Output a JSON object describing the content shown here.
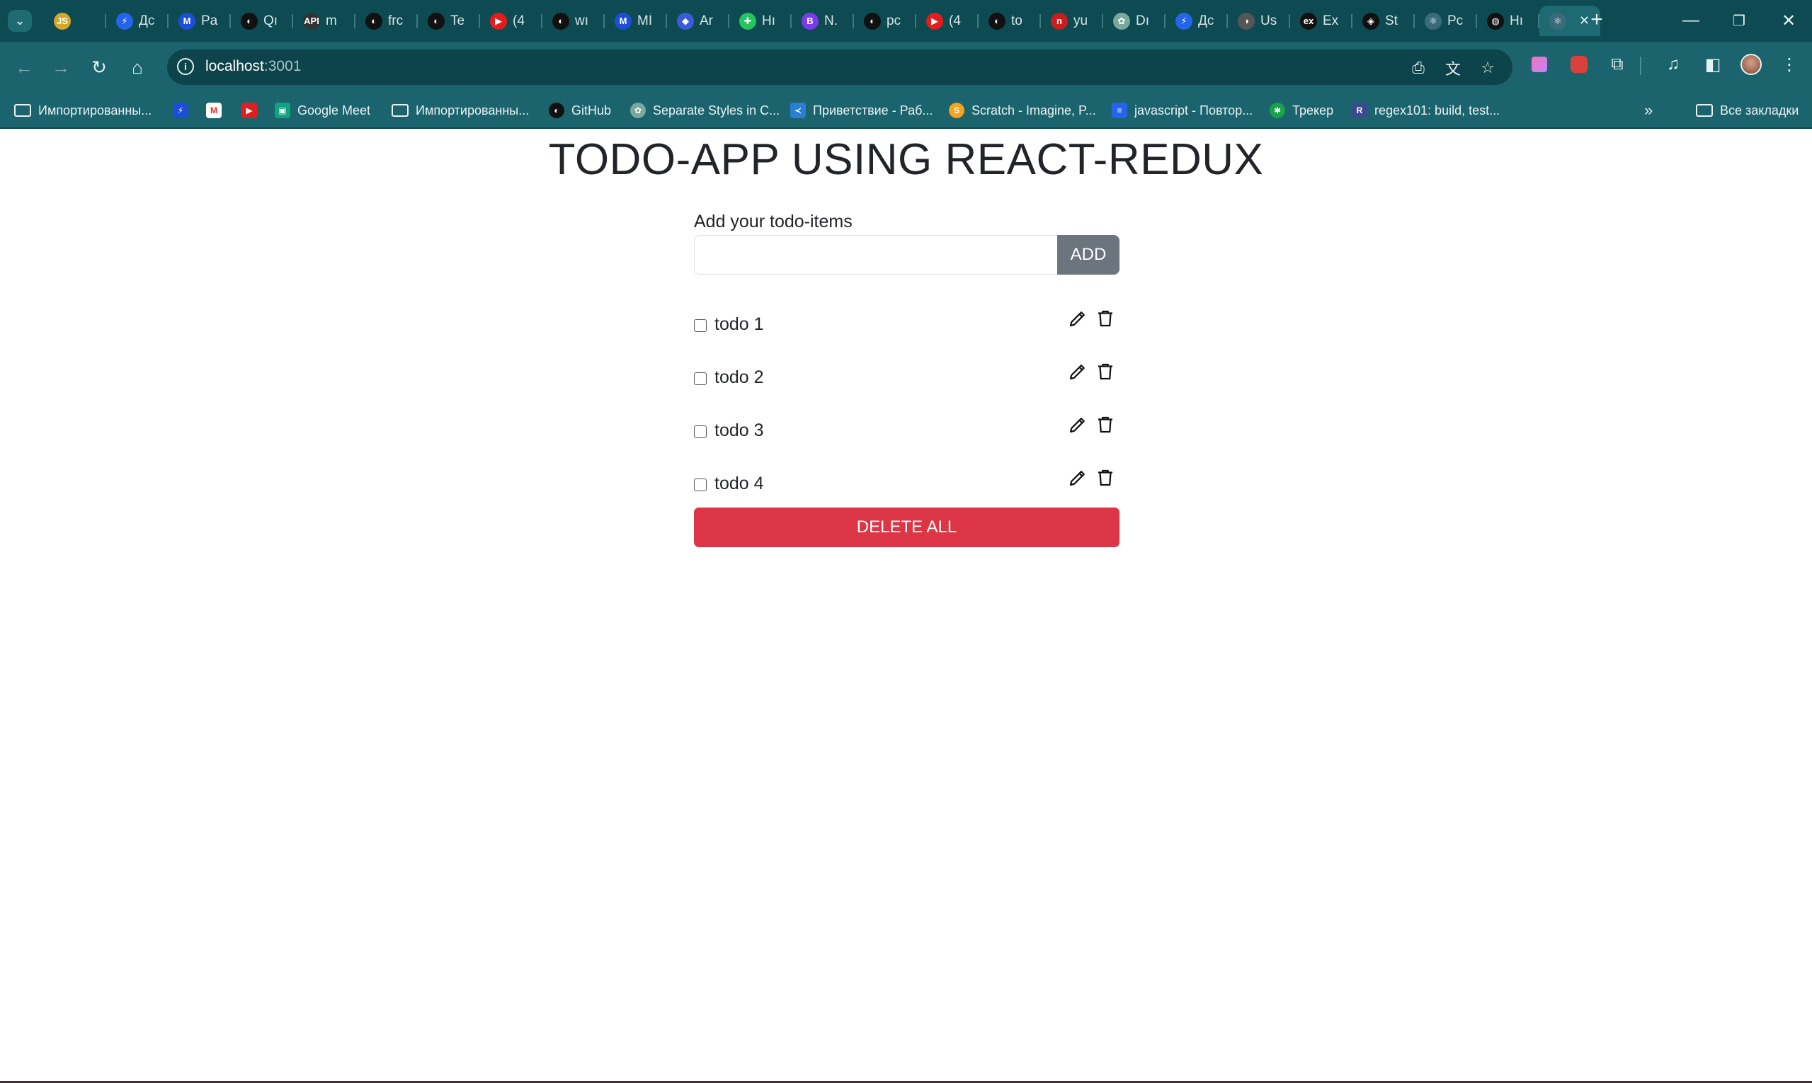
{
  "browser": {
    "tabs": [
      {
        "title": "",
        "fav_color": "#d4a72c",
        "glyph": "JS"
      },
      {
        "title": "Дс",
        "fav_color": "#2563eb",
        "glyph": "⚡"
      },
      {
        "title": "Pa",
        "fav_color": "#1d4ed8",
        "glyph": "M"
      },
      {
        "title": "Qı",
        "fav_color": "#111111",
        "glyph": "◐"
      },
      {
        "title": "m",
        "fav_color": "#333333",
        "glyph": "API"
      },
      {
        "title": "frc",
        "fav_color": "#111111",
        "glyph": "◐"
      },
      {
        "title": "Te",
        "fav_color": "#111111",
        "glyph": "◐"
      },
      {
        "title": "(4",
        "fav_color": "#e11d1d",
        "glyph": "▶"
      },
      {
        "title": "wı",
        "fav_color": "#111111",
        "glyph": "◐"
      },
      {
        "title": "Mİ",
        "fav_color": "#1d4ed8",
        "glyph": "M"
      },
      {
        "title": "Ar",
        "fav_color": "#3b5bdb",
        "glyph": "◆"
      },
      {
        "title": "Hı",
        "fav_color": "#22c55e",
        "glyph": "✚"
      },
      {
        "title": "N.",
        "fav_color": "#7c3aed",
        "glyph": "B"
      },
      {
        "title": "pc",
        "fav_color": "#111111",
        "glyph": "◐"
      },
      {
        "title": "(4",
        "fav_color": "#e11d1d",
        "glyph": "▶"
      },
      {
        "title": "to",
        "fav_color": "#111111",
        "glyph": "◐"
      },
      {
        "title": "yu",
        "fav_color": "#c81e1e",
        "glyph": "n"
      },
      {
        "title": "Dı",
        "fav_color": "#7aa89d",
        "glyph": "✿"
      },
      {
        "title": "Дс",
        "fav_color": "#2563eb",
        "glyph": "⚡"
      },
      {
        "title": "Us",
        "fav_color": "#555555",
        "glyph": "◑"
      },
      {
        "title": "Ex",
        "fav_color": "#111111",
        "glyph": "ex"
      },
      {
        "title": "St",
        "fav_color": "#111111",
        "glyph": "◈"
      },
      {
        "title": "Pc",
        "fav_color": "#3a6b7a",
        "glyph": "⚛"
      },
      {
        "title": "Hı",
        "fav_color": "#111111",
        "glyph": "◍"
      }
    ],
    "active_tab": {
      "title": "",
      "fav_color": "#3a6b7a",
      "glyph": "⚛",
      "close": "✕"
    },
    "url_host": "localhost",
    "url_port": ":3001",
    "bookmarks": {
      "imported1": "Импортированны...",
      "google_meet": "Google Meet",
      "imported2": "Импортированны...",
      "github": "GitHub",
      "separate_styles": "Separate Styles in C...",
      "vscode_welcome": "Приветствие - Раб...",
      "scratch": "Scratch - Imagine, P...",
      "js_repeat": "javascript - Повтор...",
      "tracker": "Трекер",
      "regex101": "regex101: build, test...",
      "all_bookmarks": "Все закладки"
    }
  },
  "app": {
    "title": "TODO-APP USING REACT-REDUX",
    "input_label": "Add your todo-items",
    "input_value": "",
    "add_label": "ADD",
    "todos": [
      {
        "text": "todo 1",
        "done": false
      },
      {
        "text": "todo 2",
        "done": false
      },
      {
        "text": "todo 3",
        "done": false
      },
      {
        "text": "todo 4",
        "done": false
      }
    ],
    "delete_all_label": "DELETE ALL",
    "colors": {
      "add": "#6c757d",
      "delete_all": "#dc3545",
      "chrome": "#1b646d"
    }
  }
}
